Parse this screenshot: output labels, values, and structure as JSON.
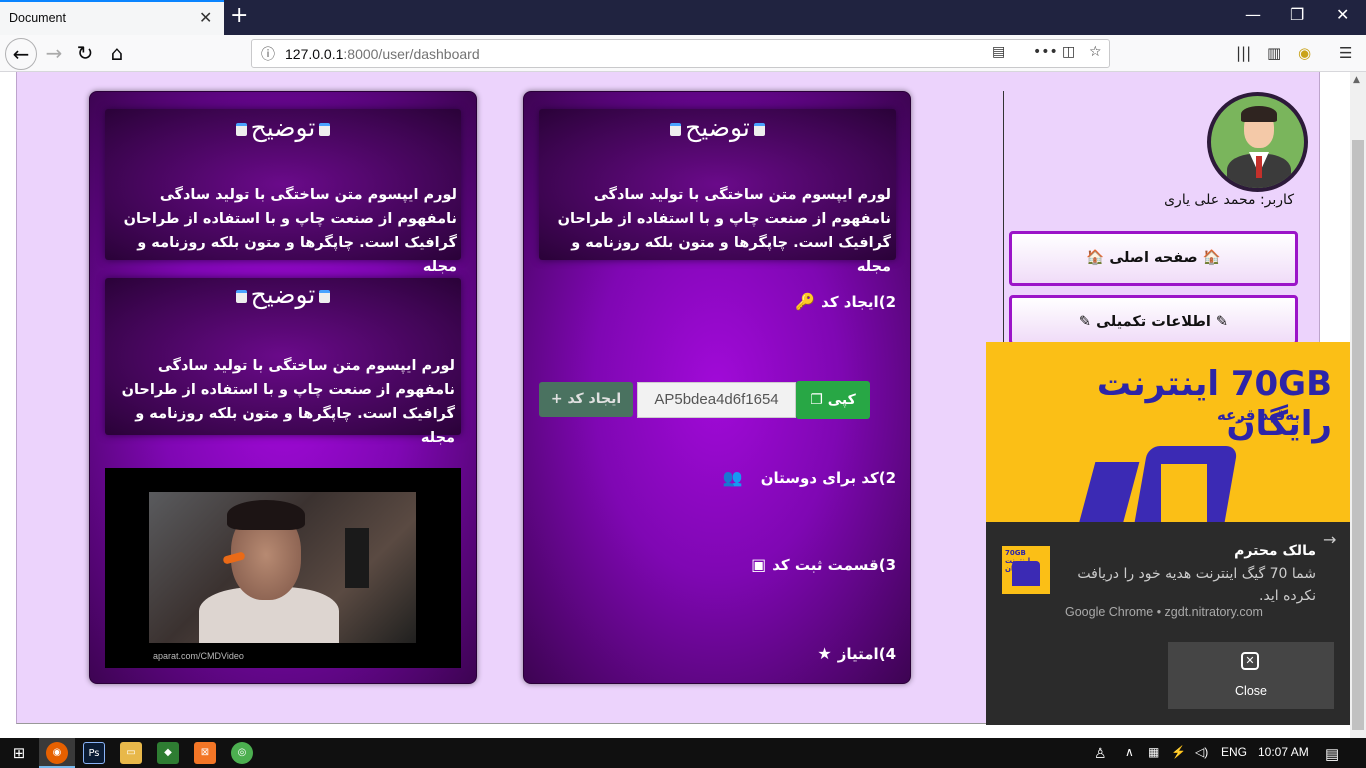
{
  "browser": {
    "tab_title": "Document",
    "url_host": "127.0.0.1",
    "url_path": ":8000/user/dashboard"
  },
  "sidebar": {
    "username": "کاربر: محمد علی یاری",
    "menu": [
      {
        "label": "صفحه اصلی",
        "icon": "home-icon"
      },
      {
        "label": "اطلاعات تکمیلی",
        "icon": "edit-icon"
      }
    ]
  },
  "main_card": {
    "desc_title": "توضیح",
    "desc_text": "لورم ایپسوم متن ساختگی با تولید سادگی نامفهوم از صنعت چاپ و با استفاده از طراحان گرافیک است. چاپگرها و متون بلکه روزنامه و مجله",
    "features": {
      "create_code": "2)ایجاد کد",
      "friends_code": "2)کد برای دوستان",
      "register_code": "3)قسمت ثبت کد",
      "points": "4)امتیاز"
    },
    "generate_button": "ایجاد کد",
    "code_value": "AP5bdea4d6f1654",
    "copy_button": "کپی"
  },
  "side_card": {
    "desc1_title": "توضیح",
    "desc1_text": "لورم ایپسوم متن ساختگی با تولید سادگی نامفهوم از صنعت چاپ و با استفاده از طراحان گرافیک است. چاپگرها و متون بلکه روزنامه و مجله",
    "desc2_title": "توضیح",
    "desc2_text": "لورم ایپسوم متن ساختگی با تولید سادگی نامفهوم از صنعت چاپ و با استفاده از طراحان گرافیک است. چاپگرها و متون بلکه روزنامه و مجله",
    "video_watermark": "aparat.com/CMDVideo"
  },
  "notification": {
    "ad_big": "70GB اینترنت رایگان",
    "ad_small": "به‌قید قرعه",
    "thumb_text": "70GB اینترنت رایگان",
    "title": "مالک محترم",
    "body": "شما 70 گیگ اینترنت هدیه خود را دریافت نکرده اید.",
    "source": "Google Chrome • zgdt.nitratory.com",
    "close_label": "Close"
  },
  "taskbar": {
    "language": "ENG",
    "time": "10:07 AM"
  }
}
